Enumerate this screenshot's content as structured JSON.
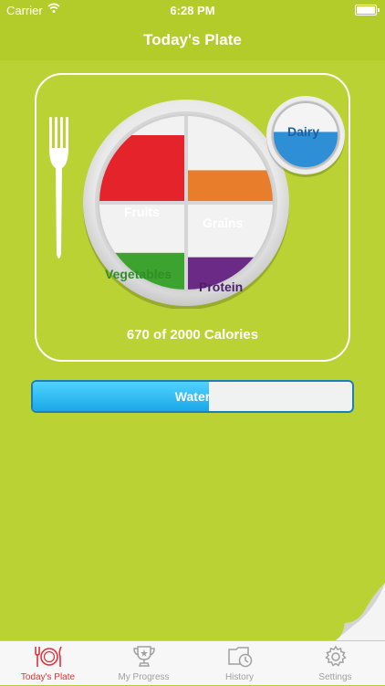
{
  "status_bar": {
    "carrier": "Carrier",
    "time": "6:28 PM"
  },
  "nav": {
    "title": "Today's Plate"
  },
  "plate": {
    "sections": {
      "fruits": "Fruits",
      "grains": "Grains",
      "vegetables": "Vegetables",
      "protein": "Protein",
      "dairy": "Dairy"
    },
    "fill_levels": {
      "fruits": 0.75,
      "grains": 0.35,
      "vegetables": 0.45,
      "protein": 0.4,
      "dairy": 0.55
    },
    "colors": {
      "fruits": "#e5232b",
      "grains": "#e87d2b",
      "vegetables": "#3da32f",
      "protein": "#6c2a87",
      "dairy": "#2f8fd6"
    },
    "calories_text": "670 of 2000 Calories"
  },
  "water": {
    "label": "Water",
    "fill_fraction": 0.55
  },
  "tabs": [
    {
      "label": "Today's Plate",
      "icon": "plate-icon",
      "active": true
    },
    {
      "label": "My Progress",
      "icon": "trophy-icon",
      "active": false
    },
    {
      "label": "History",
      "icon": "history-icon",
      "active": false
    },
    {
      "label": "Settings",
      "icon": "gear-icon",
      "active": false
    }
  ],
  "accent_color": "#b4cf2c"
}
